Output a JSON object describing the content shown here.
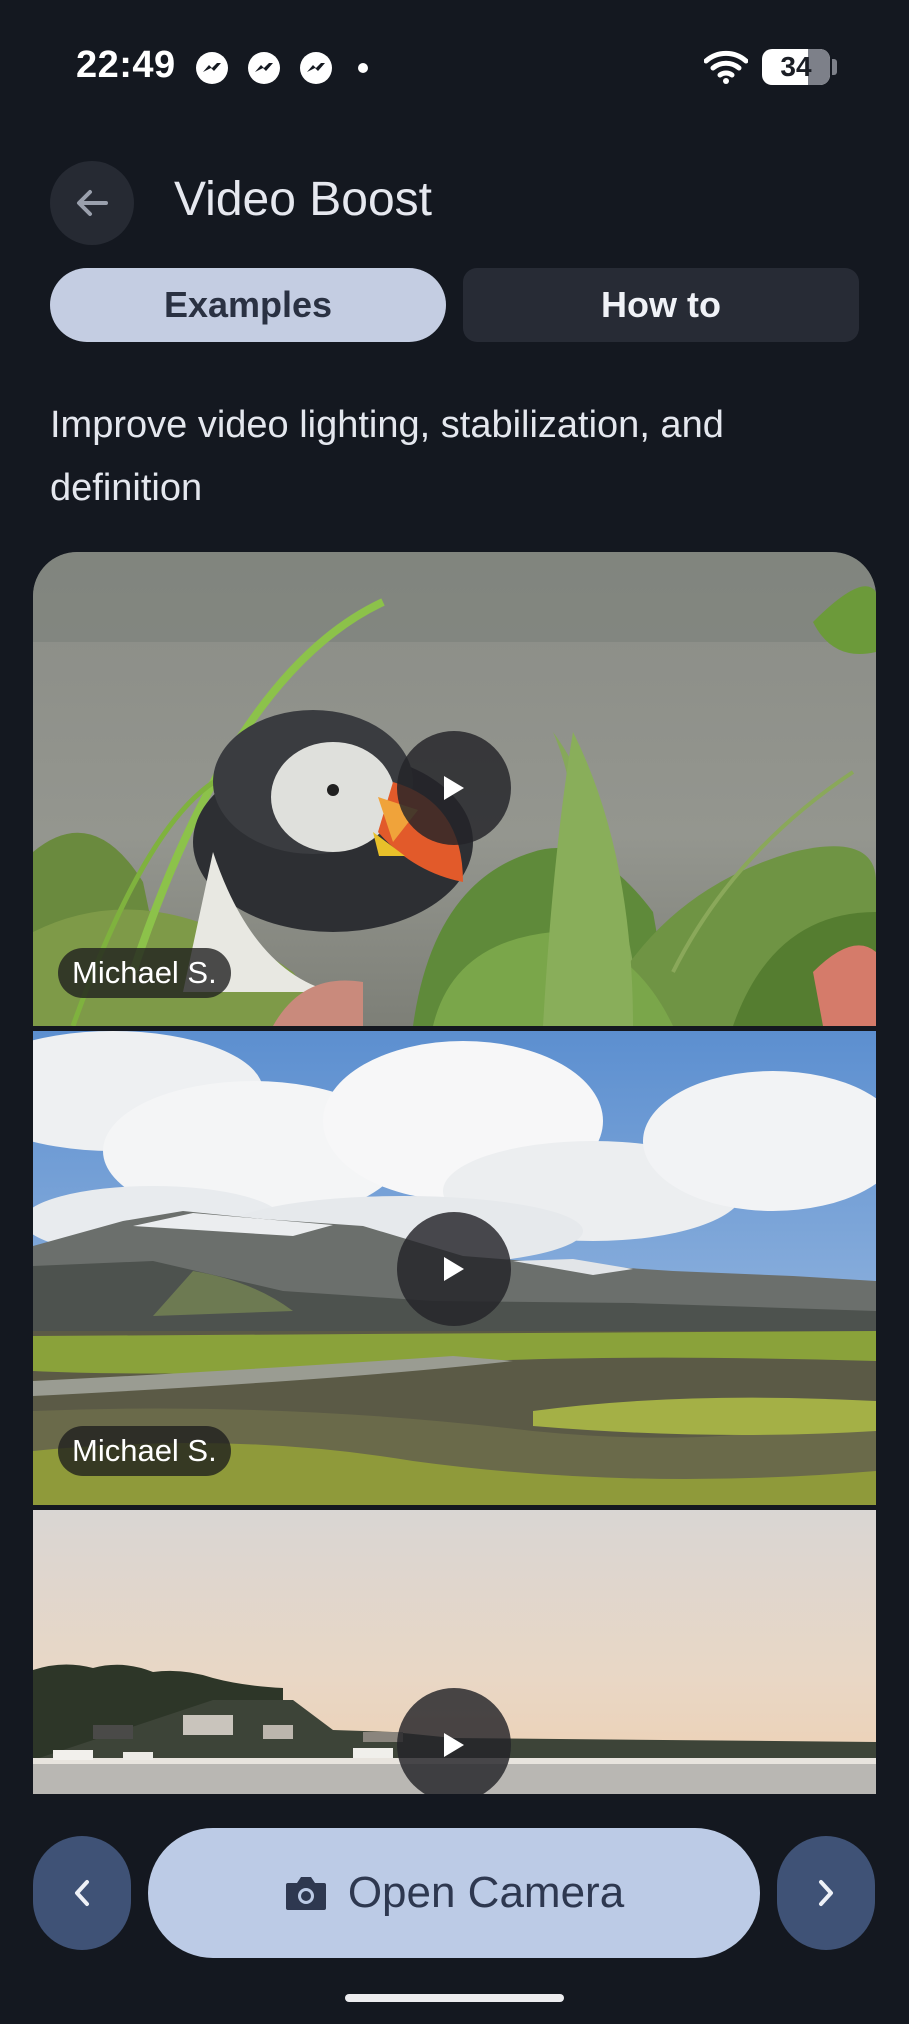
{
  "status_bar": {
    "time": "22:49",
    "notification_icons": [
      "messenger-icon",
      "messenger-icon",
      "messenger-icon",
      "dot-icon"
    ],
    "battery": "34"
  },
  "header": {
    "title": "Video Boost",
    "back_icon": "arrow-back-icon"
  },
  "tabs": [
    {
      "label": "Examples",
      "selected": true
    },
    {
      "label": "How to",
      "selected": false
    }
  ],
  "description": "Improve video lighting, stabilization, and definition",
  "examples": [
    {
      "credit": "Michael S.",
      "play_icon": "play-icon"
    },
    {
      "credit": "Michael S.",
      "play_icon": "play-icon"
    },
    {
      "credit": "",
      "play_icon": "play-icon"
    }
  ],
  "bottom_bar": {
    "prev_icon": "chevron-left-icon",
    "open_camera_label": "Open Camera",
    "camera_icon": "camera-icon",
    "next_icon": "chevron-right-icon"
  },
  "colors": {
    "background": "#141820",
    "tab_selected": "#c4cde2",
    "primary_button": "#bccbe6",
    "nav_button": "#3f5276"
  }
}
